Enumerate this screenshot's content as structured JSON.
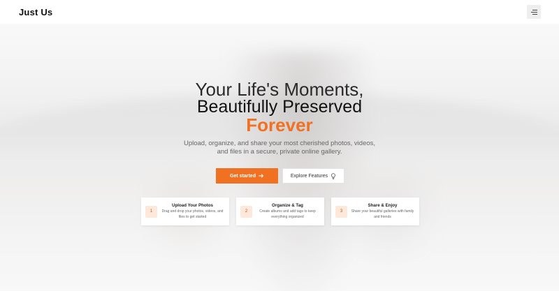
{
  "nav": {
    "brand": "Just Us",
    "menu_icon": "hamburger-menu-icon"
  },
  "hero": {
    "line1": "Your Life's Moments,",
    "line2": "Beautifully Preserved",
    "line3": "Forever",
    "subtitle": "Upload, organize, and share your most cherished photos, videos, and files in a secure, private online gallery.",
    "accent_color": "#f07122"
  },
  "actions": {
    "primary_label": "Get started",
    "primary_icon": "arrow-right-icon",
    "secondary_label": "Explore Features",
    "secondary_icon": "lightbulb-icon"
  },
  "steps": [
    {
      "number": "1",
      "title": "Upload Your Photos",
      "description": "Drag and drop your photos, videos, and files to get started"
    },
    {
      "number": "2",
      "title": "Organize & Tag",
      "description": "Create albums and add tags to keep everything organized"
    },
    {
      "number": "3",
      "title": "Share & Enjoy",
      "description": "Share your beautiful galleries with family and friends"
    }
  ]
}
